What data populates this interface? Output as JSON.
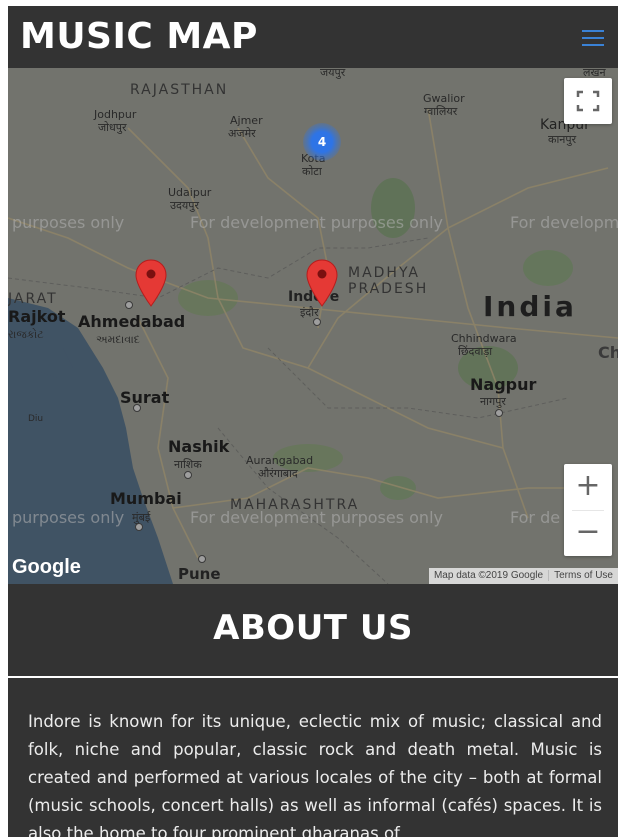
{
  "header": {
    "brand": "MUSIC MAP",
    "menu_icon": "hamburger-icon",
    "accent": "#3a82d6"
  },
  "map": {
    "watermark": "For development purposes only",
    "watermark_partial_left": "purposes only",
    "watermark_partial_right": "For developm",
    "watermark_partial_right2": "For de",
    "cluster_count": "4",
    "labels": {
      "rajasthan": "RAJASTHAN",
      "jaipur": "जयपुर",
      "lucknow_partial": "लखन",
      "gwalior": "Gwalior",
      "gwalior_hi": "ग्वालियर",
      "jodhpur": "Jodhpur",
      "jodhpur_hi": "जोधपुर",
      "ajmer": "Ajmer",
      "ajmer_hi": "अजमेर",
      "kanpur": "Kanpur",
      "kanpur_hi": "कानपुर",
      "kota": "Kota",
      "kota_hi": "कोटा",
      "udaipur": "Udaipur",
      "udaipur_hi": "उदयपुर",
      "gujarat_partial": "JARAT",
      "rajkot": "Rajkot",
      "rajkot_gu": "રાજકોટ",
      "ahmedabad": "Ahmedabad",
      "ahmedabad_gu": "અમદાવાદ",
      "indore": "Indore",
      "indore_hi": "इंदौर",
      "madhya": "MADHYA",
      "pradesh": "PRADESH",
      "india": "India",
      "chhindwara": "Chhindwara",
      "chhindwara_hi": "छिंदवाड़ा",
      "ch_partial": "Ch",
      "surat": "Surat",
      "diu": "Diu",
      "nagpur": "Nagpur",
      "nagpur_hi": "नागपुर",
      "nashik": "Nashik",
      "nashik_hi": "नाशिक",
      "aurangabad": "Aurangabad",
      "aurangabad_hi": "औरंगाबाद",
      "mumbai": "Mumbai",
      "mumbai_hi": "मुंबई",
      "maharashtra": "MAHARASHTRA",
      "pune": "Pune"
    },
    "google": "Google",
    "attribution": "Map data ©2019 Google",
    "terms": "Terms of Use",
    "zoom_in": "+",
    "zoom_out": "−",
    "fullscreen_icon": "fullscreen-icon",
    "marker_color": "#e53935"
  },
  "about": {
    "title": "ABOUT US",
    "text": "Indore is known for its unique, eclectic mix of music; classical and folk, niche and popular, classic rock and death metal. Music is created and performed at various locales of the city – both at formal (music schools, concert halls) as well as informal (cafés) spaces. It is also the home to four prominent gharanas of"
  }
}
